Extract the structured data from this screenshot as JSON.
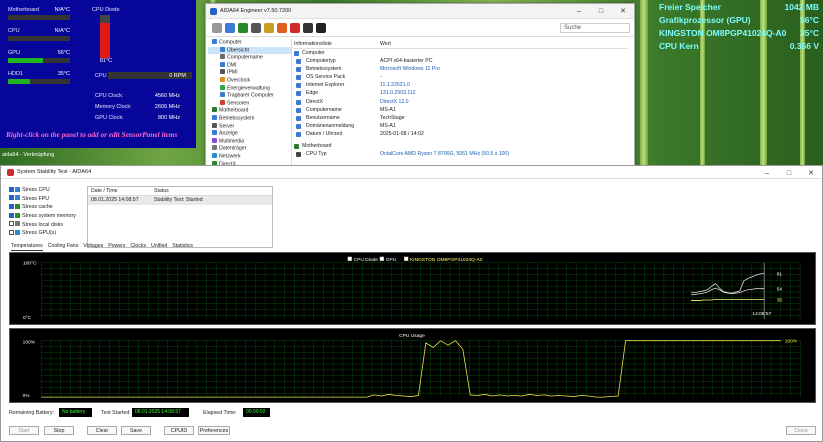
{
  "sensor_panel": {
    "motherboard_label": "Motherboard",
    "motherboard_value": "N/A°C",
    "cpu_label": "CPU",
    "cpu_value": "N/A°C",
    "gpu_label": "GPU",
    "gpu_value": "56°C",
    "gpu_level_pct": 56,
    "hdd_label": "HDD1",
    "hdd_value": "35°C",
    "hdd_level_pct": 35,
    "cpu_diode_label": "CPU Diode",
    "cpu_diode_value": "81°C",
    "cpu_diode_level_pct": 81,
    "fan_label": "CPU",
    "fan_value": "0 RPM",
    "cpu_clock_label": "CPU Clock:",
    "cpu_clock_value": "4560 MHz",
    "mem_clock_label": "Memory Clock:",
    "mem_clock_value": "2606 MHz",
    "gpu_clock_label": "GPU Clock:",
    "gpu_clock_value": "800 MHz",
    "hint": "Right-click on the panel to add or edit SensorPanel items"
  },
  "overlay": [
    {
      "label": "Freier Speicher",
      "value": "1042 MB"
    },
    {
      "label": "Grafikprozessor (GPU)",
      "value": "56°C"
    },
    {
      "label": "KINGSTON OM8PGP41024Q-A0",
      "value": "35°C"
    },
    {
      "label": "CPU Kern",
      "value": "0.356 V"
    }
  ],
  "taskbar_label": "aida64 - Verknüpfung",
  "aida_window": {
    "title": "AIDA64 Engineer v7.50.7200",
    "search_placeholder": "Suche",
    "tree": [
      {
        "label": "Computer",
        "color": "#3a7bd5"
      },
      {
        "label": "Übersicht",
        "color": "#3a7bd5",
        "selected": true
      },
      {
        "label": "Computername",
        "color": "#6a6a6a"
      },
      {
        "label": "DMI",
        "color": "#3a7bd5"
      },
      {
        "label": "IPMI",
        "color": "#555555"
      },
      {
        "label": "Overclock",
        "color": "#e08a1a"
      },
      {
        "label": "Energieverwaltung",
        "color": "#2aa84a"
      },
      {
        "label": "Tragbarer Computer",
        "color": "#3a7bd5"
      },
      {
        "label": "Sensoren",
        "color": "#d0402a"
      },
      {
        "label": "Motherboard",
        "color": "#2a7a2a"
      },
      {
        "label": "Betriebssystem",
        "color": "#3a7bd5"
      },
      {
        "label": "Server",
        "color": "#555555"
      },
      {
        "label": "Anzeige",
        "color": "#3a7bd5"
      },
      {
        "label": "Multimedia",
        "color": "#8a4ad0"
      },
      {
        "label": "Datenträger",
        "color": "#777777"
      },
      {
        "label": "Netzwerk",
        "color": "#2a8ad0"
      },
      {
        "label": "DirectX",
        "color": "#2a8a2a"
      }
    ],
    "list_header": {
      "field": "Informationsliste",
      "value": "Wert"
    },
    "section_computer": "Computer",
    "rows": [
      {
        "field": "Computertyp",
        "value": "ACPI x64-basierter PC",
        "link": false
      },
      {
        "field": "Betriebssystem",
        "value": "Microsoft Windows 11 Pro",
        "link": true
      },
      {
        "field": "OS Service Pack",
        "value": "-",
        "link": false
      },
      {
        "field": "Internet Explorer",
        "value": "11.1.22621.0",
        "link": true
      },
      {
        "field": "Edge",
        "value": "131.0.2903.112",
        "link": true
      },
      {
        "field": "DirectX",
        "value": "DirectX 12.0",
        "link": true
      },
      {
        "field": "Computername",
        "value": "MS-A1",
        "link": false
      },
      {
        "field": "Benutzername",
        "value": "TechStage",
        "link": false
      },
      {
        "field": "Domänenanmeldung",
        "value": "MS-A1",
        "link": false
      },
      {
        "field": "Datum / Uhrzeit",
        "value": "2025-01-08 / 14:02",
        "link": false
      }
    ],
    "section_motherboard": "Motherboard",
    "cpu_row": {
      "field": "CPU Typ",
      "value": "OctalCore AMD Ryzen 7 8700G, 5061 MHz (50.5 x 100)"
    }
  },
  "stability": {
    "title": "System Stability Test - AIDA64",
    "checks": [
      {
        "label": "Stress CPU",
        "checked": true
      },
      {
        "label": "Stress FPU",
        "checked": true
      },
      {
        "label": "Stress cache",
        "checked": true
      },
      {
        "label": "Stress system memory",
        "checked": true
      },
      {
        "label": "Stress local disks",
        "checked": false
      },
      {
        "label": "Stress GPU(s)",
        "checked": false
      }
    ],
    "status_header": {
      "date": "Date / Time",
      "status": "Status"
    },
    "status_row": {
      "date": "08.01.2025 14:08:57",
      "status": "Stability Test: Started"
    },
    "tabs": [
      "Temperatures",
      "Cooling Fans",
      "Voltages",
      "Powers",
      "Clocks",
      "Unified",
      "Statistics"
    ],
    "active_tab": 0,
    "temp_legend": [
      "CPU Diode",
      "GPU",
      "KINGSTON OM8PGP41024Q-A0"
    ],
    "temp_colors": [
      "#ffffff",
      "#ffffff",
      "#ffff66"
    ],
    "temp_ymax_label": "100°C",
    "temp_ymin_label": "0°C",
    "temp_time_label": "14:08:57",
    "temp_end_labels": [
      "81",
      "54",
      "35"
    ],
    "cpu_usage_title": "CPU Usage",
    "usage_ymax_label": "100%",
    "usage_ymin_label": "0%",
    "usage_end_label": "100%",
    "remaining_battery_label": "Remaining Battery:",
    "remaining_battery_value": "No battery",
    "test_started_label": "Test Started:",
    "test_started_value": "08.01.2025 14:08:57",
    "elapsed_label": "Elapsed Time:",
    "elapsed_value": "00:00:02",
    "buttons": [
      "Start",
      "Stop",
      "Clear",
      "Save",
      "CPUID",
      "Preferences"
    ],
    "close_label": "Close"
  },
  "chart_data": [
    {
      "type": "line",
      "title": "",
      "ylim": [
        0,
        100
      ],
      "series": [
        {
          "name": "CPU Diode",
          "values": [
            48,
            47,
            49,
            50,
            52,
            58,
            63,
            55,
            49,
            47,
            46,
            48,
            50,
            68,
            72,
            75,
            78,
            80,
            81
          ]
        },
        {
          "name": "GPU",
          "values": [
            44,
            44,
            45,
            46,
            48,
            52,
            55,
            52,
            48,
            46,
            45,
            46,
            47,
            50,
            52,
            53,
            54,
            54,
            54
          ]
        },
        {
          "name": "KINGSTON OM8PGP41024Q-A0",
          "values": [
            33,
            33,
            33,
            34,
            34,
            34,
            35,
            35,
            35,
            35,
            35,
            35,
            35,
            35,
            35,
            35,
            35,
            35,
            35
          ]
        }
      ]
    },
    {
      "type": "line",
      "title": "CPU Usage",
      "ylim": [
        0,
        100
      ],
      "series": [
        {
          "name": "",
          "values": [
            0,
            0,
            0,
            0,
            0,
            0,
            0,
            0,
            0,
            0,
            0,
            0,
            0,
            0,
            0,
            0,
            0,
            0,
            0,
            0,
            0,
            0,
            0,
            0,
            0,
            0,
            0,
            0,
            0,
            0,
            0,
            0,
            0,
            0,
            0,
            0,
            0,
            0,
            0,
            0,
            0,
            0,
            0,
            0,
            0,
            4,
            2,
            5,
            3,
            2,
            1,
            3,
            96,
            88,
            100,
            92,
            100,
            85,
            4,
            3,
            5,
            2,
            4,
            2,
            3,
            2,
            5,
            3,
            4,
            2,
            3,
            2,
            1,
            3,
            2,
            0,
            0,
            1,
            2,
            100,
            100,
            100,
            100,
            100,
            100,
            100,
            100,
            100,
            100,
            100,
            100,
            100,
            100,
            100,
            100,
            100,
            100,
            100,
            100,
            100,
            100
          ]
        }
      ]
    }
  ]
}
